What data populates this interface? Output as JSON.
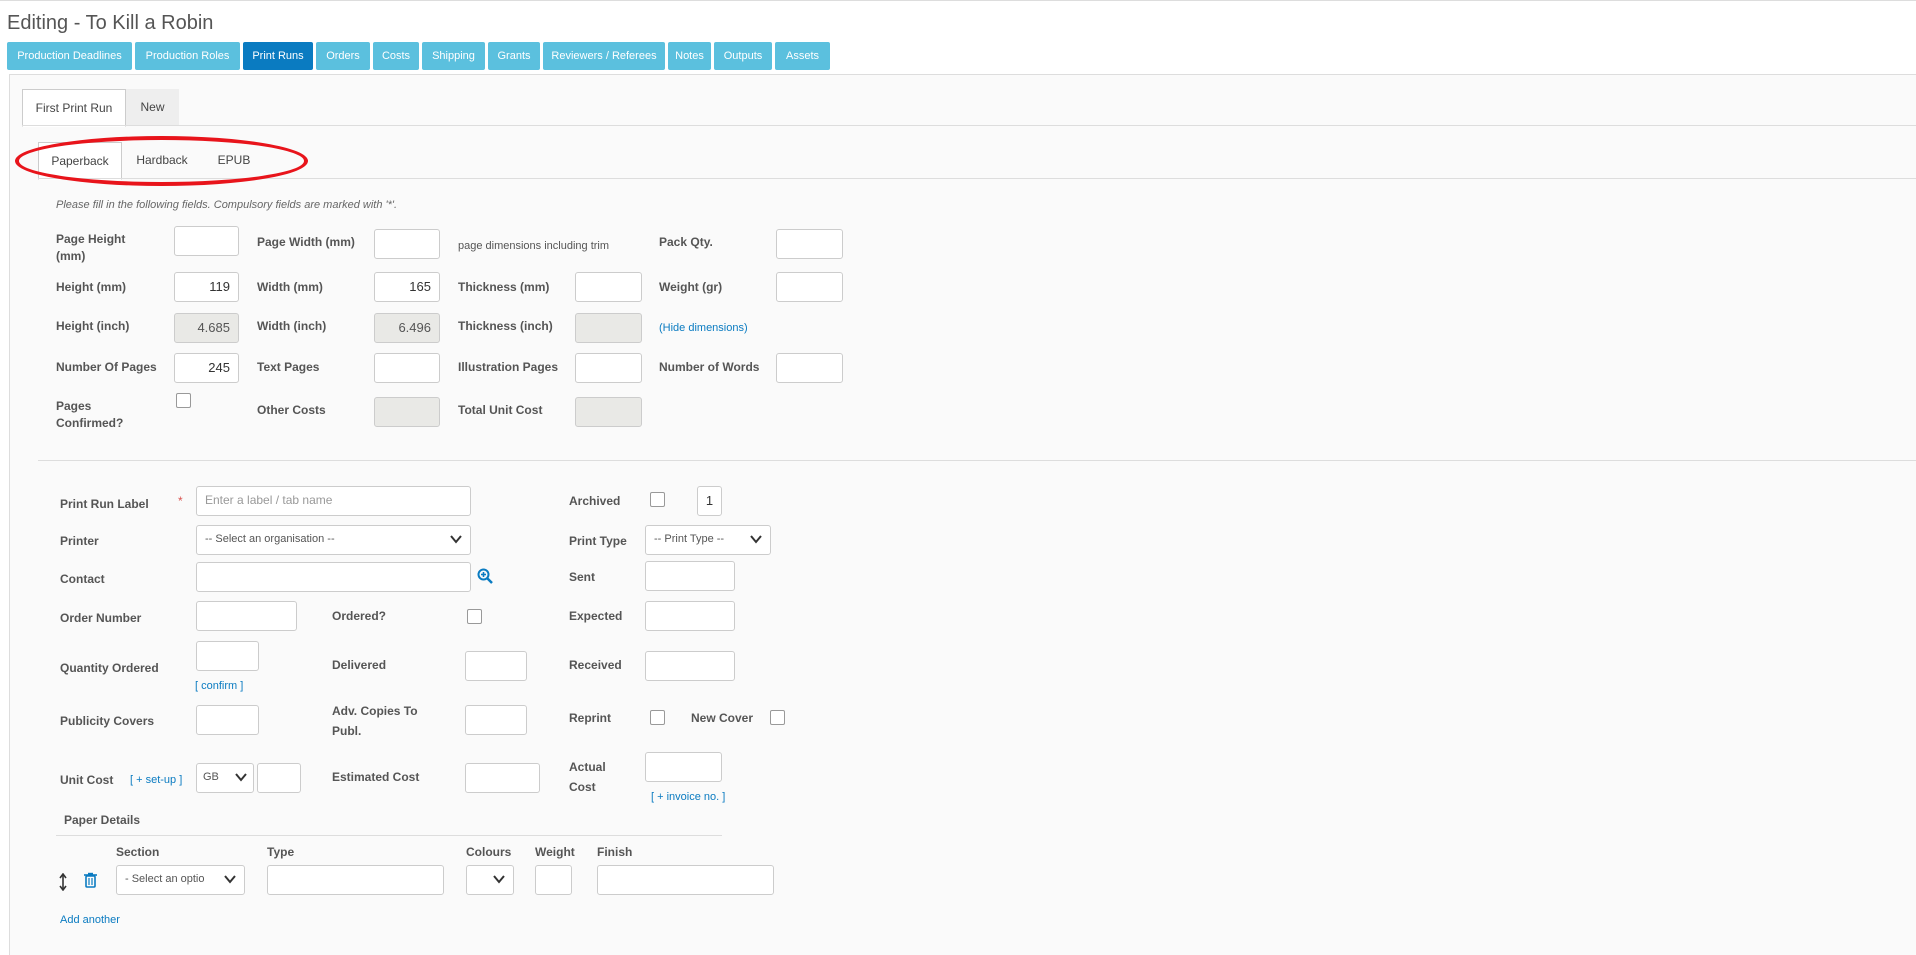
{
  "page": {
    "title": "Editing - To Kill a Robin"
  },
  "nav": {
    "tabs": [
      "Production Deadlines",
      "Production Roles",
      "Print Runs",
      "Orders",
      "Costs",
      "Shipping",
      "Grants",
      "Reviewers / Referees",
      "Notes",
      "Outputs",
      "Assets"
    ],
    "active": "Print Runs"
  },
  "run_tabs": [
    "First Print Run",
    "New"
  ],
  "format_tabs": [
    "Paperback",
    "Hardback",
    "EPUB"
  ],
  "dimensions": {
    "instructions": "Please fill in the following fields. Compulsory fields are marked with '*'.",
    "page_height_label": "Page Height (mm)",
    "page_width_label": "Page Width (mm)",
    "page_dims_note": "page dimensions including trim",
    "pack_qty_label": "Pack Qty.",
    "height_mm_label": "Height (mm)",
    "height_mm_value": "119",
    "width_mm_label": "Width (mm)",
    "width_mm_value": "165",
    "thickness_mm_label": "Thickness (mm)",
    "weight_label": "Weight (gr)",
    "height_inch_label": "Height (inch)",
    "height_inch_value": "4.685",
    "width_inch_label": "Width (inch)",
    "width_inch_value": "6.496",
    "thickness_inch_label": "Thickness (inch)",
    "hide_dimensions": "(Hide dimensions)",
    "num_pages_label": "Number Of Pages",
    "num_pages_value": "245",
    "text_pages_label": "Text Pages",
    "illustration_pages_label": "Illustration Pages",
    "num_words_label": "Number of Words",
    "pages_confirmed_label": "Pages Confirmed?",
    "other_costs_label": "Other Costs",
    "total_unit_cost_label": "Total Unit Cost"
  },
  "print_run": {
    "label_label": "Print Run Label",
    "required_mark": "*",
    "label_placeholder": "Enter a label / tab name",
    "archived_label": "Archived",
    "archived_count": "1",
    "printer_label": "Printer",
    "printer_value": "-- Select an organisation --",
    "print_type_label": "Print Type",
    "print_type_value": "-- Print Type --",
    "contact_label": "Contact",
    "sent_label": "Sent",
    "order_number_label": "Order Number",
    "ordered_label": "Ordered?",
    "expected_label": "Expected",
    "quantity_ordered_label": "Quantity Ordered",
    "confirm_link": "[ confirm ]",
    "delivered_label": "Delivered",
    "received_label": "Received",
    "publicity_covers_label": "Publicity Covers",
    "adv_copies_label": "Adv. Copies To Publ.",
    "reprint_label": "Reprint",
    "new_cover_label": "New Cover",
    "unit_cost_label": "Unit Cost",
    "setup_link": "[ + set-up ]",
    "currency_value": "GB",
    "estimated_cost_label": "Estimated Cost",
    "actual_cost_label": "Actual Cost",
    "invoice_link": "[ + invoice no. ]"
  },
  "paper_details": {
    "title": "Paper Details",
    "columns": [
      "Section",
      "Type",
      "Colours",
      "Weight",
      "Finish"
    ],
    "section_value": "- Select an optio",
    "add_another": "Add another"
  },
  "colors": {
    "nav_button": "#5bc0de",
    "nav_active": "#0a7bc1",
    "annotation": "#e8141b"
  },
  "icons": [
    "sort-icon",
    "trash-icon",
    "search-plus-icon",
    "chevron-down-icon"
  ]
}
